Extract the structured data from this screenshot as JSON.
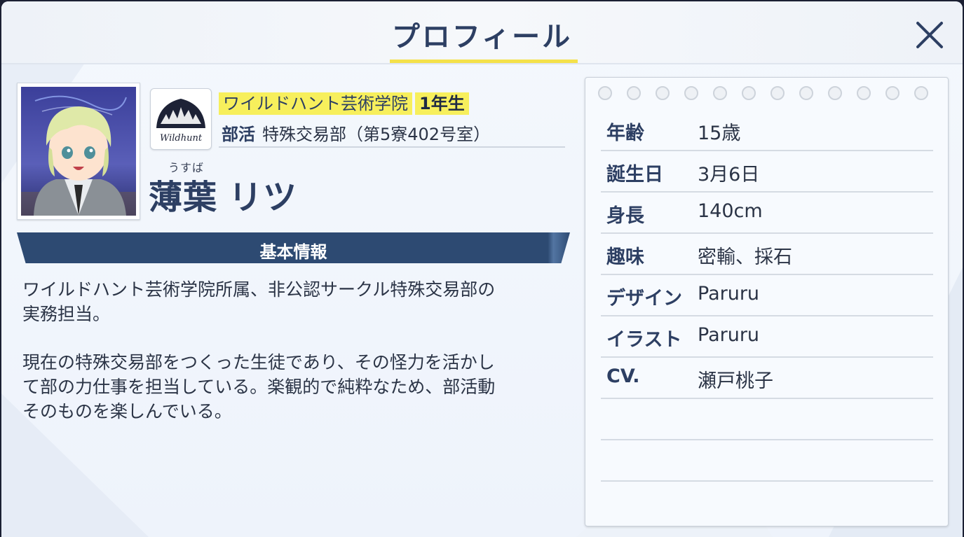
{
  "header": {
    "title": "プロフィール"
  },
  "character": {
    "school": "ワイルドハント芸術学院",
    "grade": "1年生",
    "club_label": "部活",
    "club_value": "特殊交易部（第5寮402号室）",
    "name_ruby": "うすば",
    "family_name": "薄葉",
    "given_name": "リツ",
    "emblem_text": "Wildhunt"
  },
  "section": {
    "title": "基本情報"
  },
  "description": {
    "paragraphs": [
      "ワイルドハント芸術学院所属、非公認サークル特殊交易部の\n実務担当。",
      "現在の特殊交易部をつくった生徒であり、その怪力を活かし\nて部の力仕事を担当している。楽観的で純粋なため、部活動\nそのものを楽しんでいる。"
    ]
  },
  "profile": [
    {
      "label": "年齢",
      "value": "15歳"
    },
    {
      "label": "誕生日",
      "value": "3月6日"
    },
    {
      "label": "身長",
      "value": "140cm"
    },
    {
      "label": "趣味",
      "value": "密輸、採石"
    },
    {
      "label": "デザイン",
      "value": "Paruru"
    },
    {
      "label": "イラスト",
      "value": "Paruru"
    },
    {
      "label": "CV.",
      "value": "瀬戸桃子"
    },
    {
      "label": "",
      "value": ""
    },
    {
      "label": "",
      "value": ""
    }
  ],
  "colors": {
    "accent_navy": "#2d3f63",
    "highlight_yellow": "#f7ef5c",
    "section_bar": "#2d4a72"
  }
}
